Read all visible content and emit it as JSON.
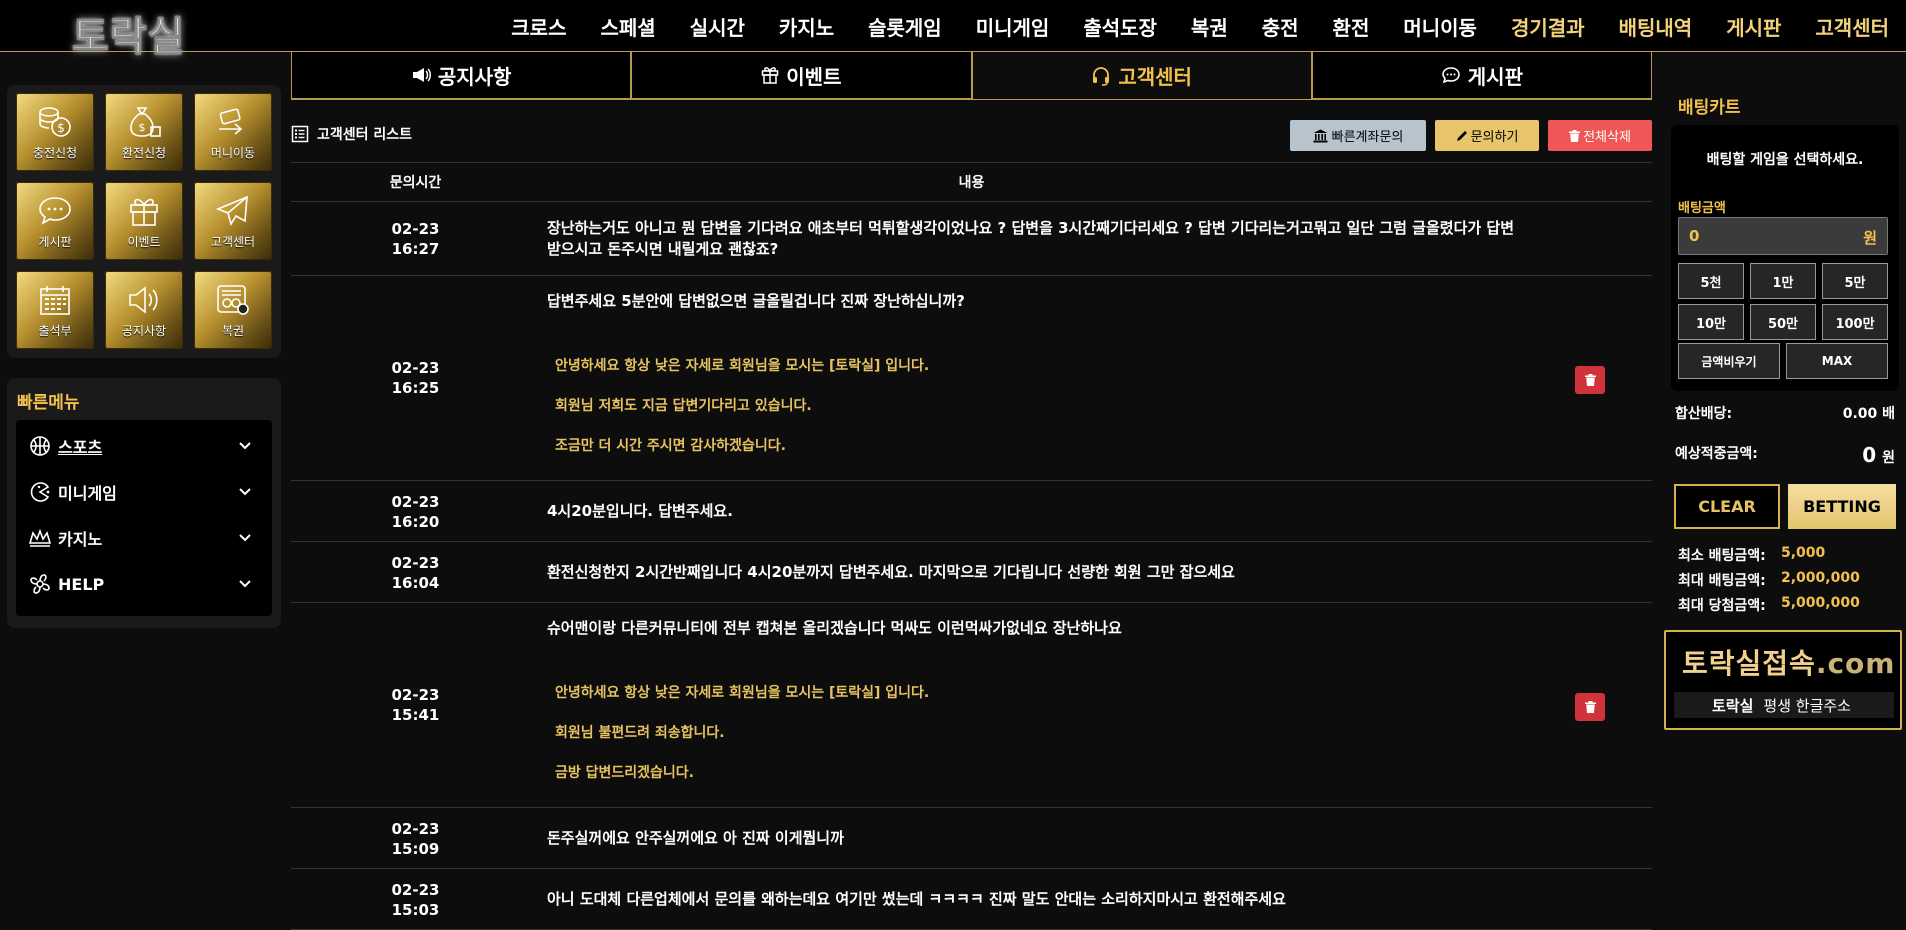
{
  "header": {
    "logo": "토락실",
    "nav": [
      {
        "label": "크로스",
        "gold": false
      },
      {
        "label": "스페셜",
        "gold": false
      },
      {
        "label": "실시간",
        "gold": false
      },
      {
        "label": "카지노",
        "gold": false
      },
      {
        "label": "슬롯게임",
        "gold": false
      },
      {
        "label": "미니게임",
        "gold": false
      },
      {
        "label": "출석도장",
        "gold": false
      },
      {
        "label": "복권",
        "gold": false
      },
      {
        "label": "충전",
        "gold": false
      },
      {
        "label": "환전",
        "gold": false
      },
      {
        "label": "머니이동",
        "gold": false
      },
      {
        "label": "경기결과",
        "gold": true
      },
      {
        "label": "배팅내역",
        "gold": true
      },
      {
        "label": "게시판",
        "gold": true
      },
      {
        "label": "고객센터",
        "gold": true
      }
    ]
  },
  "tiles": [
    {
      "label": "충전신청",
      "icon": "coins-icon"
    },
    {
      "label": "환전신청",
      "icon": "money-bag-icon"
    },
    {
      "label": "머니이동",
      "icon": "money-transfer-icon"
    },
    {
      "label": "게시판",
      "icon": "chat-bubble-icon"
    },
    {
      "label": "이벤트",
      "icon": "gift-icon"
    },
    {
      "label": "고객센터",
      "icon": "paper-plane-icon"
    },
    {
      "label": "출석부",
      "icon": "calendar-icon"
    },
    {
      "label": "공지사항",
      "icon": "speaker-icon"
    },
    {
      "label": "복권",
      "icon": "lottery-ticket-icon"
    }
  ],
  "quick_menu": {
    "title": "빠른메뉴",
    "items": [
      {
        "label": "스포츠",
        "icon": "basketball-icon"
      },
      {
        "label": "미니게임",
        "icon": "pacman-icon"
      },
      {
        "label": "카지노",
        "icon": "crown-icon"
      },
      {
        "label": "HELP",
        "icon": "help-icon"
      }
    ]
  },
  "tabs": [
    {
      "label": "공지사항",
      "icon": "megaphone-icon"
    },
    {
      "label": "이벤트",
      "icon": "gift-icon"
    },
    {
      "label": "고객센터",
      "icon": "headset-icon",
      "active": true
    },
    {
      "label": "게시판",
      "icon": "comment-icon"
    }
  ],
  "list": {
    "title": "고객센터 리스트",
    "buttons": {
      "quick_account": "빠른계좌문의",
      "inquire": "문의하기",
      "delete_all": "전체삭제"
    },
    "columns": {
      "time": "문의시간",
      "content": "내용"
    },
    "rows": [
      {
        "date": "02-23",
        "time": "16:27",
        "text": "장난하는거도 아니고 뭔 답변을 기다려요 애초부터 먹튀할생각이었나요 ? 답변을 3시간째기다리세요 ? 답변 기다리는거고뭐고 일단 그럼 글올렸다가 답변 받으시고 돈주시면 내릴게요 괜찮죠?",
        "answers": []
      },
      {
        "date": "02-23",
        "time": "16:25",
        "text": "답변주세요 5분안에 답변없으면 글올릴겁니다 진짜 장난하십니까?",
        "answers": [
          "안녕하세요 항상 낮은 자세로 회원님을 모시는 [토락실] 입니다.",
          "회원님 저희도 지금 답변기다리고 있습니다.",
          "조금만 더 시간 주시면 감사하겠습니다."
        ]
      },
      {
        "date": "02-23",
        "time": "16:20",
        "text": "4시20분입니다. 답변주세요.",
        "answers": []
      },
      {
        "date": "02-23",
        "time": "16:04",
        "text": "환전신청한지 2시간반째입니다 4시20분까지 답변주세요. 마지막으로 기다립니다 선량한 회원 그만 잡으세요",
        "answers": []
      },
      {
        "date": "02-23",
        "time": "15:41",
        "text": "슈어맨이랑 다른커뮤니티에 전부 캡쳐본 올리겠습니다 먹싸도 이런먹싸가없네요 장난하나요",
        "answers": [
          "안녕하세요 항상 낮은 자세로 회원님을 모시는 [토락실] 입니다.",
          "회원님 불편드려 죄송합니다.",
          "금방 답변드리겠습니다."
        ]
      },
      {
        "date": "02-23",
        "time": "15:09",
        "text": "돈주실꺼에요 안주실꺼에요 아 진짜 이게뭡니까",
        "answers": []
      },
      {
        "date": "02-23",
        "time": "15:03",
        "text": "아니 도대체 다른업체에서 문의를 왜하는데요 여기만 썼는데 ㅋㅋㅋㅋ 진짜 말도 안대는 소리하지마시고 환전해주세요",
        "answers": []
      }
    ]
  },
  "bet_cart": {
    "title": "배팅카트",
    "message": "배팅할 게임을 선택하세요.",
    "amount_label": "배팅금액",
    "amount_value": "0",
    "amount_unit": "원",
    "chips": [
      "5천",
      "1만",
      "5만",
      "10만",
      "50만",
      "100만"
    ],
    "reset_label": "금액비우기",
    "max_label": "MAX",
    "odds_label": "합산배당:",
    "odds_value": "0.00 배",
    "expected_label": "예상적중금액:",
    "expected_value": "0",
    "expected_unit": "원",
    "clear_label": "CLEAR",
    "betting_label": "BETTING",
    "limits": [
      {
        "label": "최소 배팅금액:",
        "value": "5,000"
      },
      {
        "label": "최대 배팅금액:",
        "value": "2,000,000"
      },
      {
        "label": "최대 당첨금액:",
        "value": "5,000,000"
      }
    ]
  },
  "banner": {
    "domain_main": "토락실접속",
    "domain_ext": ".com",
    "strip_logo": "토락실",
    "strip_text": "평생 한글주소"
  },
  "colors": {
    "gold": "#f2c14e",
    "answer": "#e6c260",
    "delete": "#d0343a"
  }
}
